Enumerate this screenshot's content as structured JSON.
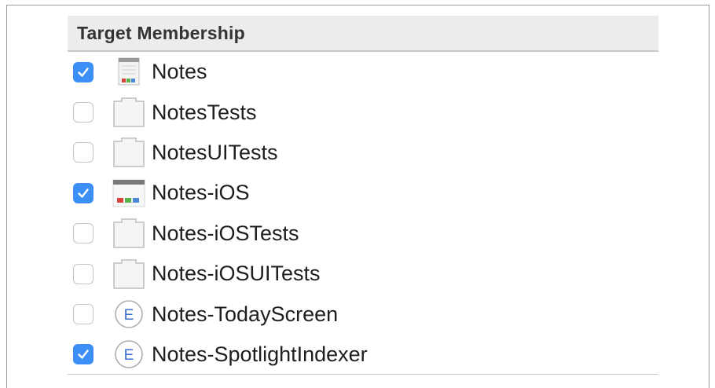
{
  "panel": {
    "title": "Target Membership",
    "targets": [
      {
        "label": "Notes",
        "checked": true,
        "icon": "macos-app-icon"
      },
      {
        "label": "NotesTests",
        "checked": false,
        "icon": "test-bundle-icon"
      },
      {
        "label": "NotesUITests",
        "checked": false,
        "icon": "test-bundle-icon"
      },
      {
        "label": "Notes-iOS",
        "checked": true,
        "icon": "ios-app-icon"
      },
      {
        "label": "Notes-iOSTests",
        "checked": false,
        "icon": "test-bundle-icon"
      },
      {
        "label": "Notes-iOSUITests",
        "checked": false,
        "icon": "test-bundle-icon"
      },
      {
        "label": "Notes-TodayScreen",
        "checked": false,
        "icon": "extension-icon",
        "icon_glyph": "E"
      },
      {
        "label": "Notes-SpotlightIndexer",
        "checked": true,
        "icon": "extension-icon",
        "icon_glyph": "E"
      }
    ]
  },
  "colors": {
    "checkbox_checked": "#3b8ff6",
    "extension_glyph": "#3b6fd6"
  }
}
